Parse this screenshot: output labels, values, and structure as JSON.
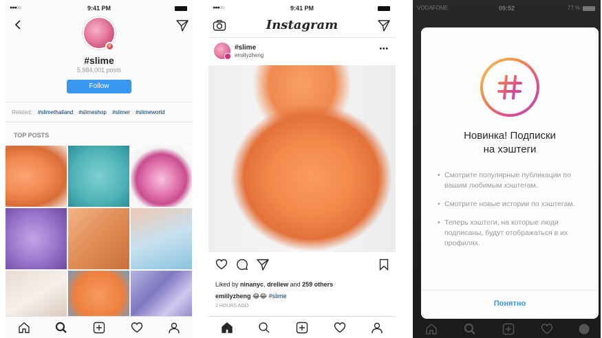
{
  "phone1": {
    "status": {
      "time": "9:41 PM"
    },
    "hashtag": "#slime",
    "post_count": "5,984,001 posts",
    "follow_label": "Follow",
    "related_label": "Related:",
    "related_tags": [
      "#slimethailand",
      "#slimeshop",
      "#slimer",
      "#slimeworld"
    ],
    "top_posts_label": "TOP POSTS"
  },
  "phone2": {
    "status": {
      "time": "9:41 PM"
    },
    "logo": "Instagram",
    "post": {
      "hashtag": "#slime",
      "username": "emiilyzheng",
      "more": "•••",
      "likes_prefix": "Liked by ",
      "likes_user1": "ninanyc",
      "likes_sep": ", ",
      "likes_user2": "drellew",
      "likes_and": " and ",
      "likes_count": "259 others",
      "caption_user": "emiilyzheng",
      "caption_emoji": " 😂😂 ",
      "caption_tag": "#slime",
      "time_ago": "2 HOURS AGO"
    }
  },
  "phone3": {
    "status": {
      "carrier": "VODAFONE",
      "time": "09:52",
      "battery": "77 %"
    },
    "modal": {
      "title_line1": "Новинка! Подписки",
      "title_line2": "на хэштеги",
      "bullets": [
        "Смотрите популярные публикации по вашим любимым хэштегам.",
        "Смотрите новые истории по хэштегам.",
        "Теперь хэштеги, на которые люди подписаны, будут отображаться в их профилях."
      ],
      "button": "Понятно"
    }
  }
}
